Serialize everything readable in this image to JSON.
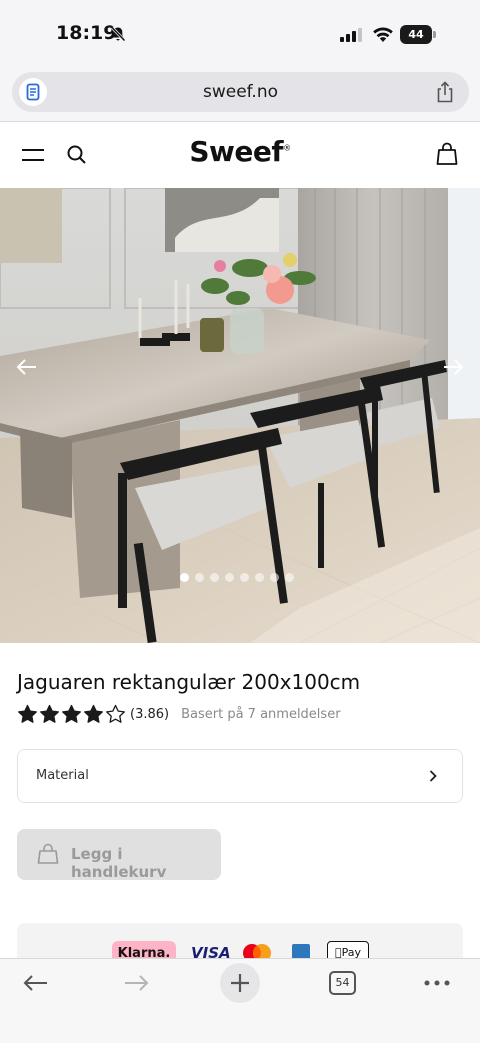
{
  "status_bar": {
    "time": "18:19",
    "battery": "44"
  },
  "browser": {
    "url": "sweef.no"
  },
  "site": {
    "logo": "Sweef"
  },
  "hero": {
    "slide_count": 8,
    "active_slide": 1
  },
  "product": {
    "title": "Jaguaren rektangulær 200x100cm",
    "rating_value": "(3.86)",
    "rating_stars": 3.86,
    "reviews_text": "Basert på 7 anmeldelser",
    "material_label": "Material",
    "cart_button_label": "Legg i handlekurv"
  },
  "payments": {
    "klarna": "Klarna.",
    "visa": "VISA",
    "applepay": "Pay"
  },
  "toolbar": {
    "tabs_count": "54"
  },
  "colors": {
    "accent": "#111111",
    "cart_button_bg": "#e0e0e0",
    "klarna_pink": "#ffb3c7"
  }
}
